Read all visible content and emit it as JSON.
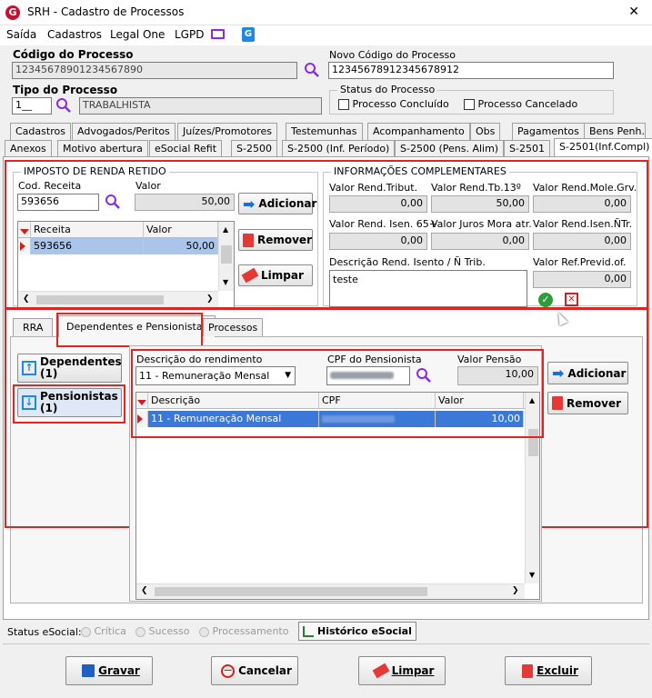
{
  "window": {
    "title": "SRH - Cadastro de Processos",
    "close_glyph": "✕"
  },
  "menu": [
    "Saída",
    "Cadastros",
    "Legal One",
    "LGPD"
  ],
  "codigo_processo": {
    "label": "Código do Processo",
    "value": "12345678901234567890"
  },
  "novo_codigo": {
    "label": "Novo Código do Processo",
    "value": "12345678912345678912"
  },
  "tipo_processo": {
    "label": "Tipo do Processo",
    "code": "1__",
    "name": "TRABALHISTA"
  },
  "status_processo": {
    "label": "Status do Processo",
    "concluido": "Processo Concluído",
    "cancelado": "Processo Cancelado"
  },
  "tabs_row1": [
    "Cadastros",
    "Advogados/Peritos",
    "Juízes/Promotores",
    "Testemunhas",
    "Acompanhamento",
    "Obs",
    "Pagamentos",
    "Bens Penh."
  ],
  "tabs_row2": [
    "Anexos",
    "Motivo abertura",
    "eSocial Refit",
    "S-2500",
    "S-2500 (Inf. Período)",
    "S-2500 (Pens. Alim)",
    "S-2501",
    "S-2501(Inf.Compl)"
  ],
  "irrf": {
    "title": "IMPOSTO DE RENDA RETIDO",
    "cod_receita_label": "Cod. Receita",
    "cod_receita_value": "593656",
    "valor_label": "Valor",
    "valor_value": "50,00",
    "grid_headers": [
      "Receita",
      "Valor"
    ],
    "grid_rows": [
      {
        "receita": "593656",
        "valor": "50,00"
      }
    ],
    "btn_adicionar": "Adicionar",
    "btn_remover": "Remover",
    "btn_limpar": "Limpar"
  },
  "info_compl": {
    "title": "INFORMAÇÕES COMPLEMENTARES",
    "fields": [
      {
        "label": "Valor Rend.Tribut.",
        "value": "0,00"
      },
      {
        "label": "Valor Rend.Tb.13º",
        "value": "50,00"
      },
      {
        "label": "Valor Rend.Mole.Grv.",
        "value": "0,00"
      },
      {
        "label": "Valor Rend. Isen. 65+",
        "value": "0,00"
      },
      {
        "label": "Valor Juros Mora atr.",
        "value": "0,00"
      },
      {
        "label": "Valor Rend.Isen.ÑTr.",
        "value": "0,00"
      }
    ],
    "descricao_label": "Descrição Rend. Isento / Ñ Trib.",
    "descricao_value": "teste",
    "ref_previd_label": "Valor Ref.Previd.of.",
    "ref_previd_value": "0,00"
  },
  "subtabs": [
    "RRA",
    "Dependentes e Pensionistas",
    "Processos"
  ],
  "side_buttons": {
    "dependentes": "Dependentes (1)",
    "pensionistas": "Pensionistas (1)"
  },
  "pensao": {
    "descricao_label": "Descrição do rendimento",
    "descricao_value": "11 - Remuneração Mensal",
    "cpf_label": "CPF do Pensionista",
    "valor_label": "Valor Pensão",
    "valor_value": "10,00",
    "grid_headers": [
      "Descrição",
      "CPF",
      "Valor"
    ],
    "grid_rows": [
      {
        "descricao": "11 - Remuneração Mensal",
        "valor": "10,00"
      }
    ],
    "btn_adicionar": "Adicionar",
    "btn_remover": "Remover"
  },
  "status_esocial": {
    "label": "Status eSocial:",
    "critica": "Crítica",
    "sucesso": "Sucesso",
    "processamento": "Processamento",
    "historico": "Histórico eSocial"
  },
  "bottom_buttons": {
    "gravar": "Gravar",
    "cancelar": "Cancelar",
    "limpar": "Limpar",
    "excluir": "Excluir"
  },
  "colors": {
    "accent_red": "#e32222",
    "selection": "#3b78d8",
    "purple": "#8a2be2"
  }
}
